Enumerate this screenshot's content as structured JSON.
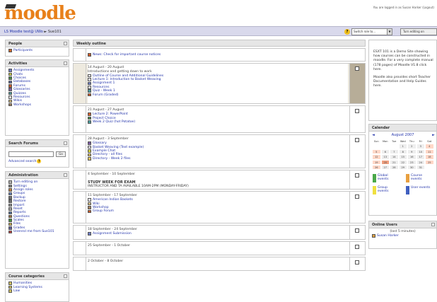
{
  "header": {
    "logo": "moodle",
    "login_info": "You are logged in as Susan Harker (Logout)"
  },
  "navbar": {
    "breadcrumb": [
      "LS Moodle test@ UWo",
      "Sue101"
    ],
    "sep": "►",
    "help": "?",
    "switch_role": "Switch role to...",
    "turn_editing": "Turn editing on"
  },
  "people": {
    "title": "People",
    "items": [
      {
        "label": "Participants",
        "icon": "participants-icon"
      }
    ]
  },
  "activities": {
    "title": "Activities",
    "items": [
      {
        "label": "Assignments",
        "icon": "assignment-icon"
      },
      {
        "label": "Chats",
        "icon": "chat-icon"
      },
      {
        "label": "Choices",
        "icon": "choice-icon"
      },
      {
        "label": "Databases",
        "icon": "database-icon"
      },
      {
        "label": "Forums",
        "icon": "forum-icon"
      },
      {
        "label": "Glossaries",
        "icon": "glossary-icon"
      },
      {
        "label": "Quizzes",
        "icon": "quiz-icon"
      },
      {
        "label": "Resources",
        "icon": "resource-icon"
      },
      {
        "label": "Wikis",
        "icon": "wiki-icon"
      },
      {
        "label": "Workshops",
        "icon": "workshop-icon"
      }
    ]
  },
  "search_forums": {
    "title": "Search Forums",
    "go": "Go",
    "advanced": "Advanced search",
    "help": "?"
  },
  "administration": {
    "title": "Administration",
    "items": [
      {
        "label": "Turn editing on",
        "icon": "edit-icon"
      },
      {
        "label": "Settings",
        "icon": "settings-icon"
      },
      {
        "label": "Assign roles",
        "icon": "roles-icon"
      },
      {
        "label": "Groups",
        "icon": "groups-icon"
      },
      {
        "label": "Backup",
        "icon": "backup-icon"
      },
      {
        "label": "Restore",
        "icon": "restore-icon"
      },
      {
        "label": "Import",
        "icon": "import-icon"
      },
      {
        "label": "Reset",
        "icon": "reset-icon"
      },
      {
        "label": "Reports",
        "icon": "reports-icon"
      },
      {
        "label": "Questions",
        "icon": "questions-icon"
      },
      {
        "label": "Scales",
        "icon": "scales-icon"
      },
      {
        "label": "Files",
        "icon": "files-icon"
      },
      {
        "label": "Grades",
        "icon": "grades-icon"
      },
      {
        "label": "Unenrol me from Sue101",
        "icon": "unenrol-icon"
      }
    ]
  },
  "course_categories": {
    "title": "Course categories",
    "items": [
      {
        "label": "Humanities",
        "icon": "category-icon"
      },
      {
        "label": "Learning Systems",
        "icon": "category-icon"
      },
      {
        "label": "Law",
        "icon": "category-icon"
      }
    ]
  },
  "outline": {
    "title": "Weekly outline",
    "news": "News: Check for important course notices",
    "sections": [
      {
        "date": "14 August - 20 August",
        "items": [
          {
            "label": "Introductions and getting down to work",
            "icon": "",
            "plain": true
          },
          {
            "label": "Outline of Course and Additional Guidelines",
            "icon": "document-icon"
          },
          {
            "label": "Lecture 1: Introduction to Basket Weaving",
            "icon": "document-icon"
          },
          {
            "label": "Assignment 1",
            "icon": "assignment-icon"
          },
          {
            "label": "Resources",
            "icon": "resource-icon"
          },
          {
            "label": "Quiz - Week 1",
            "icon": "quiz-icon"
          },
          {
            "label": "Forum (Graded)",
            "icon": "forum-icon"
          }
        ]
      },
      {
        "date": "21 August - 27 August",
        "items": [
          {
            "label": "Lecture 2: PowerPoint",
            "icon": "powerpoint-icon"
          },
          {
            "label": "Project Choice",
            "icon": "choice-icon"
          },
          {
            "label": "Week 2 Quiz (hot Potatoe)",
            "icon": "quiz-icon"
          }
        ]
      },
      {
        "date": "28 August - 3 September",
        "items": [
          {
            "label": "Glossary",
            "icon": "glossary-icon"
          },
          {
            "label": "Basket Weaving (Text example)",
            "icon": "document-icon"
          },
          {
            "label": "Example Chat",
            "icon": "chat-icon"
          },
          {
            "label": "Directory - all files",
            "icon": "folder-icon"
          },
          {
            "label": "Directory - Week 2 files",
            "icon": "folder-icon"
          }
        ]
      },
      {
        "date": "4 September - 10 September",
        "study": "STUDY WEEK FOR EXAM",
        "instr": "INSTRUCTOR AND TA AVAILABLE 10AM-2PM (MONDAY-FRIDAY)",
        "items": []
      },
      {
        "date": "11 September - 17 September",
        "items": [
          {
            "label": "American Indian Baskets",
            "icon": "document-icon"
          },
          {
            "label": "Wiki",
            "icon": "wiki-icon"
          },
          {
            "label": "Workshop",
            "icon": "workshop-icon"
          },
          {
            "label": "Group Forum",
            "icon": "forum-icon"
          }
        ]
      },
      {
        "date": "18 September - 24 September",
        "items": [
          {
            "label": "Assignment Submission",
            "icon": "assignment-icon"
          }
        ]
      },
      {
        "date": "25 September - 1 October",
        "items": []
      },
      {
        "date": "2 October - 8 October",
        "items": []
      }
    ]
  },
  "esxt": {
    "text1": "ESXT 101 is a Demo Site showing how courses can be constructed in moodle. For a very complete manual (178 pages) of Moodle V1.8 click here.",
    "text2": "Moodle also provides short Teacher Documentation and Help Guides here."
  },
  "calendar": {
    "title": "Calendar",
    "month": "August 2007",
    "prev": "◄",
    "next": "►",
    "days": [
      "Sun",
      "Mon",
      "Tue",
      "Wed",
      "Thu",
      "Fri",
      "Sat"
    ],
    "weeks": [
      [
        "",
        "",
        "",
        "1",
        "2",
        "3",
        "4"
      ],
      [
        "5",
        "6",
        "7",
        "8",
        "9",
        "10",
        "11"
      ],
      [
        "12",
        "13",
        "14",
        "15",
        "16",
        "17",
        "18"
      ],
      [
        "19",
        "20",
        "21",
        "22",
        "23",
        "24",
        "25"
      ],
      [
        "26",
        "27",
        "28",
        "29",
        "30",
        "31",
        ""
      ]
    ],
    "today": "20",
    "legend": [
      {
        "label": "Global events",
        "color": "#4aa84a"
      },
      {
        "label": "Course events",
        "color": "#e8a040"
      },
      {
        "label": "Group events",
        "color": "#f0e040"
      },
      {
        "label": "User events",
        "color": "#4060c0"
      }
    ]
  },
  "online_users": {
    "title": "Online Users",
    "period": "(last 5 minutes)",
    "users": [
      "Susan Harker"
    ]
  }
}
